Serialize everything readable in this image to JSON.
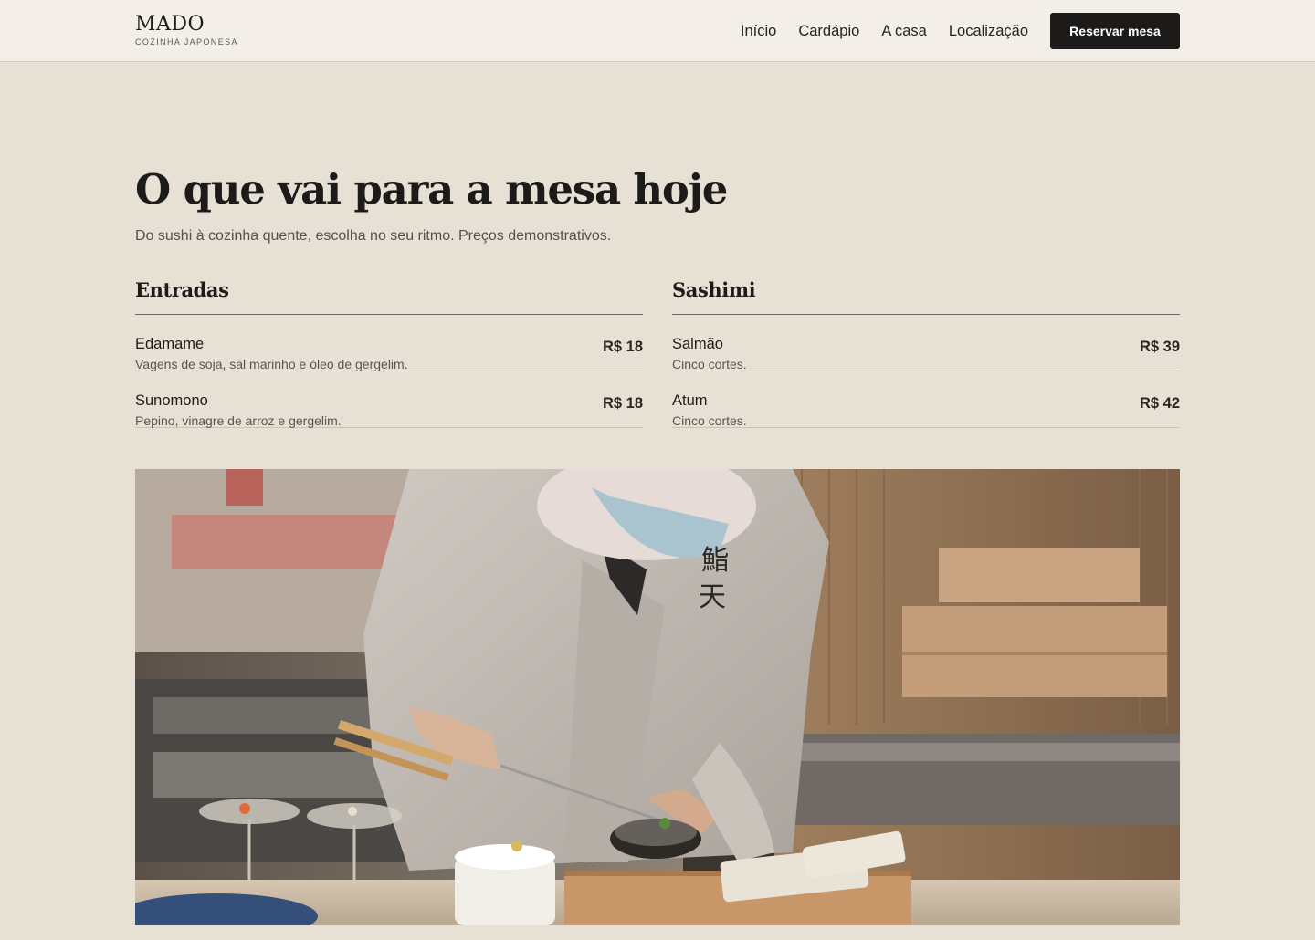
{
  "header": {
    "brand_name": "MADO",
    "brand_tagline": "COZINHA JAPONESA",
    "nav": [
      {
        "label": "Início"
      },
      {
        "label": "Cardápio"
      },
      {
        "label": "A casa"
      },
      {
        "label": "Localização"
      }
    ],
    "cta_label": "Reservar mesa"
  },
  "hero": {
    "title": "O que vai para a mesa hoje",
    "subtitle": "Do sushi à cozinha quente, escolha no seu ritmo. Preços demonstrativos."
  },
  "menu": {
    "sections": [
      {
        "title": "Entradas",
        "items": [
          {
            "name": "Edamame",
            "description": "Vagens de soja, sal marinho e óleo de gergelim.",
            "price": "R$ 18"
          },
          {
            "name": "Sunomono",
            "description": "Pepino, vinagre de arroz e gergelim.",
            "price": "R$ 18"
          }
        ]
      },
      {
        "title": "Sashimi",
        "items": [
          {
            "name": "Salmão",
            "description": "Cinco cortes.",
            "price": "R$ 39"
          },
          {
            "name": "Atum",
            "description": "Cinco cortes.",
            "price": "R$ 42"
          }
        ]
      }
    ]
  },
  "photo": {
    "jacket_characters": "鮨天"
  },
  "colors": {
    "background": "#e7e0d4",
    "header_background": "#f3efe8",
    "cta_background": "#1c1b19",
    "text": "#1e1d1b"
  }
}
